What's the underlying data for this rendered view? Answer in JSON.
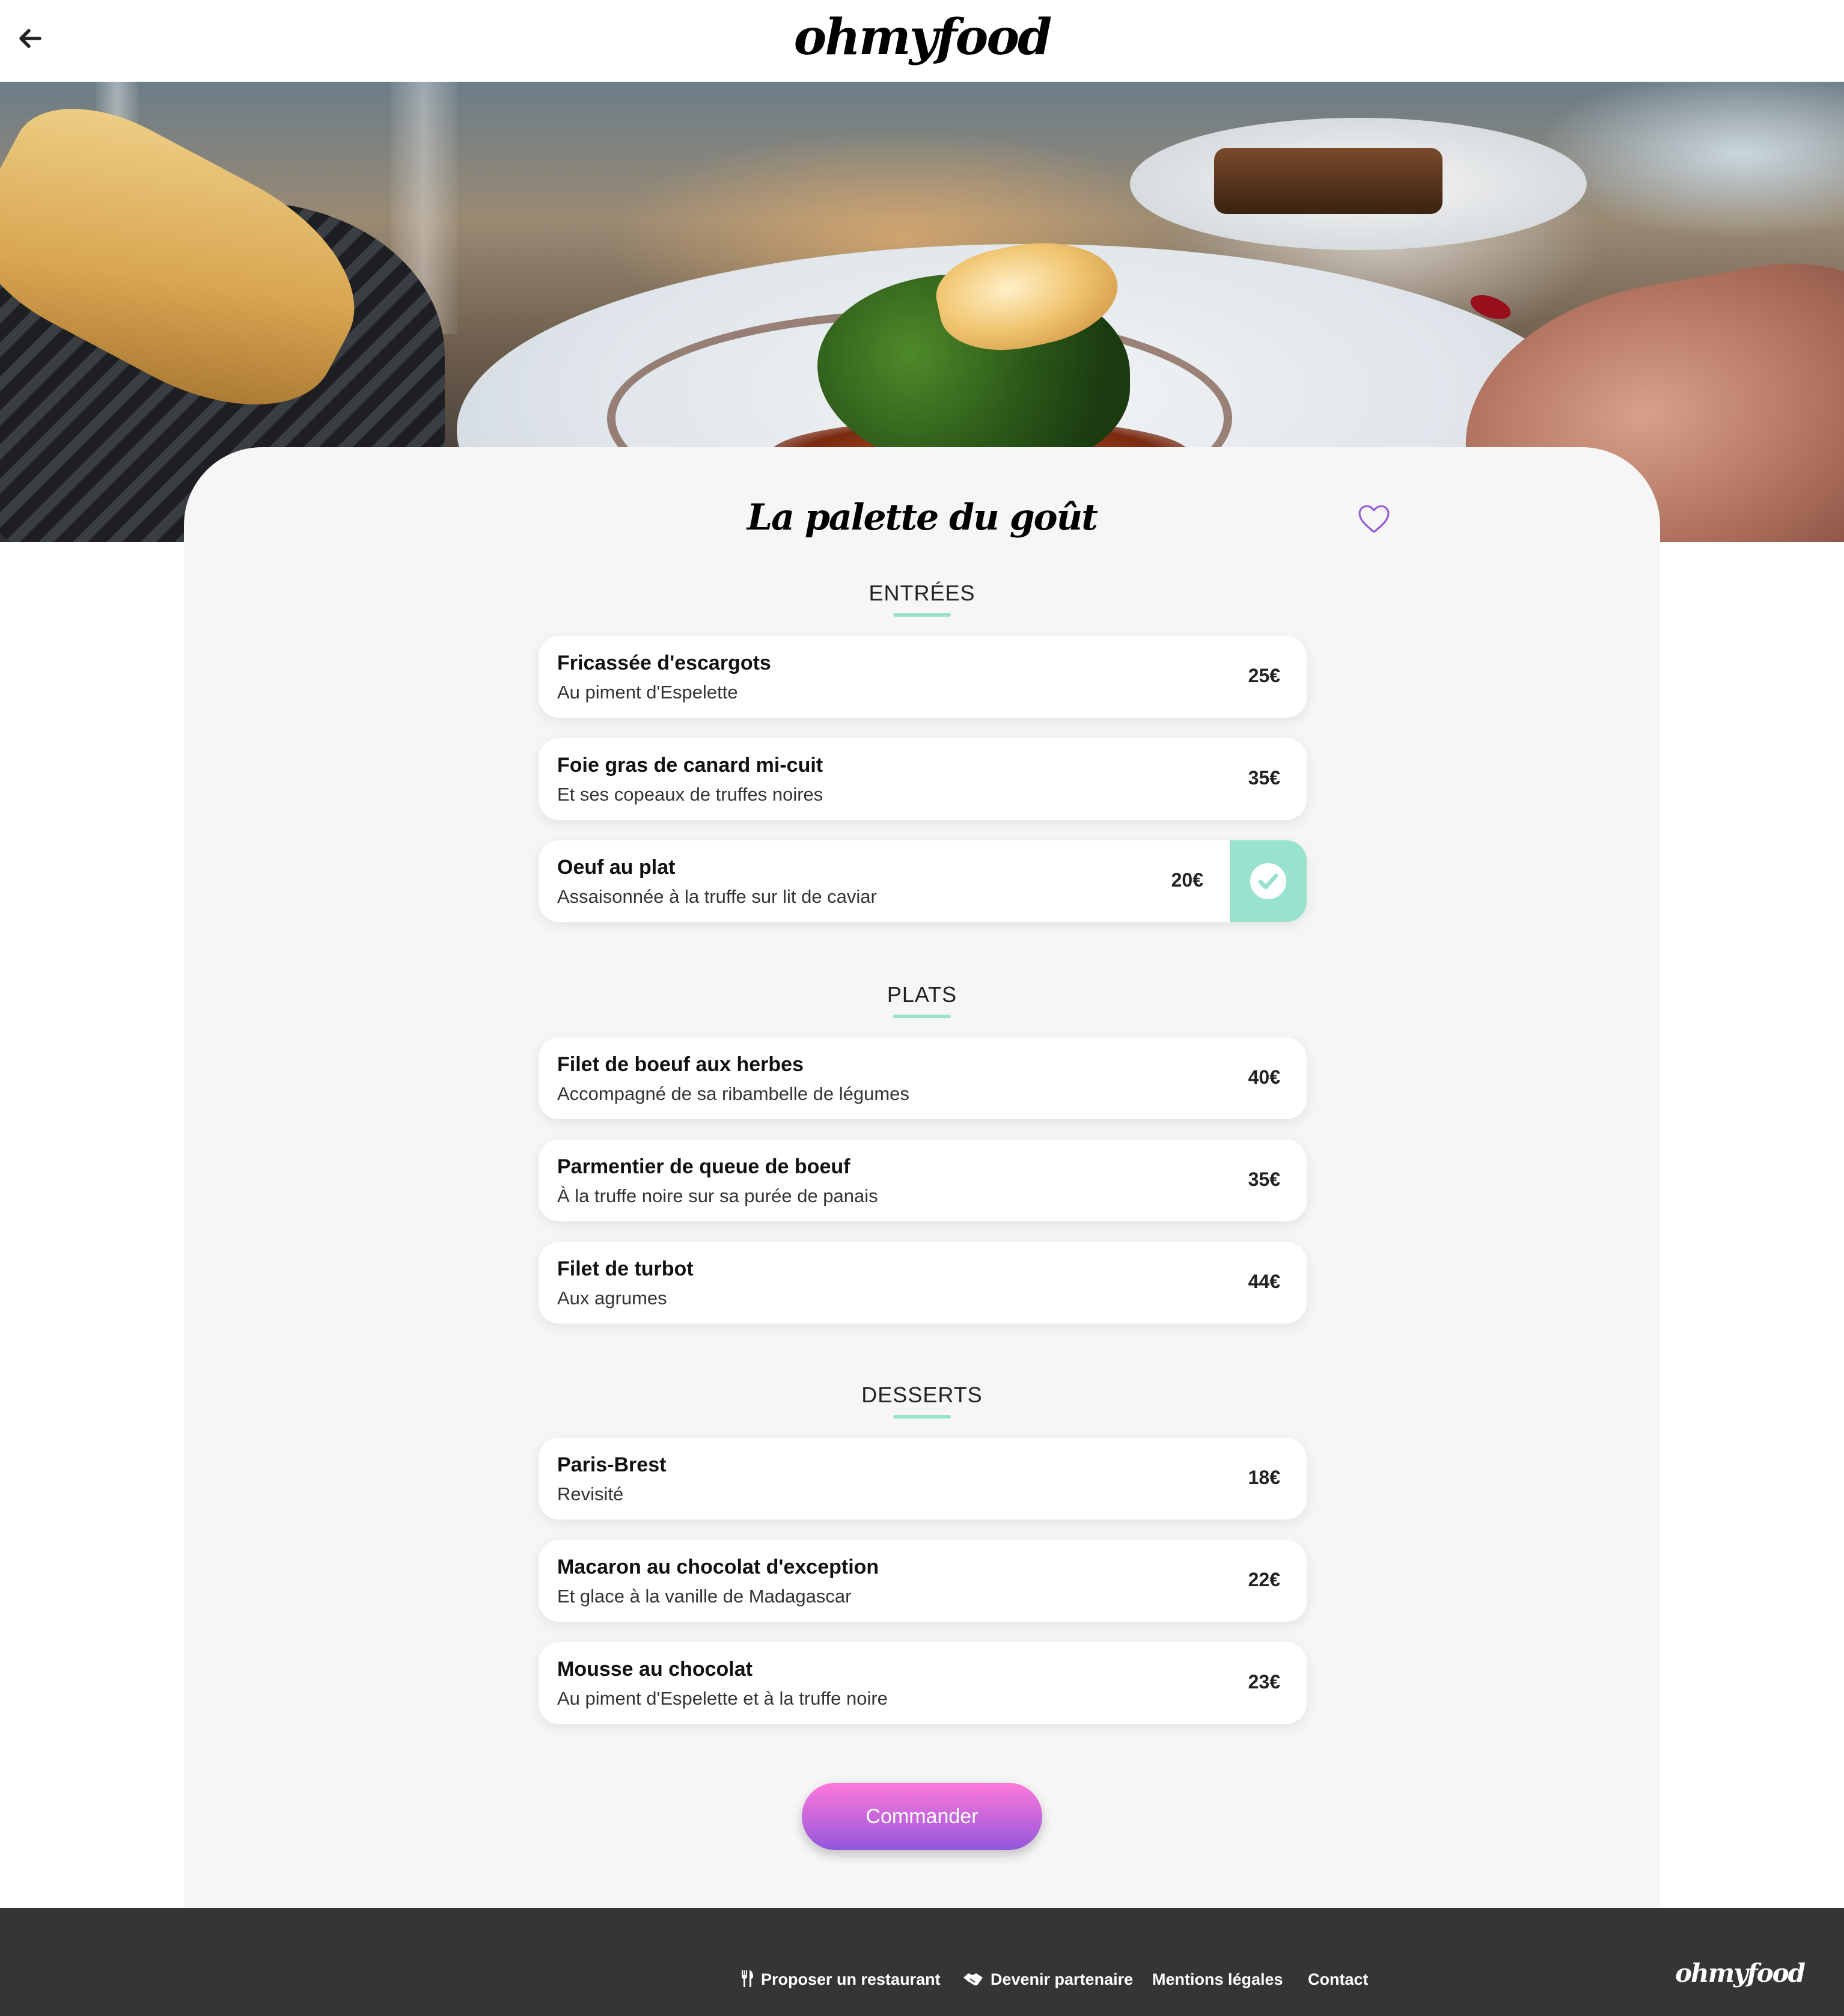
{
  "header": {
    "logo": "ohmyfood",
    "back_icon": "arrow-left-icon"
  },
  "hero": {
    "image": "restaurant-dish-photo"
  },
  "restaurant": {
    "title": "La palette du goût",
    "favorite_icon": "heart-outline-icon"
  },
  "menu": {
    "sections": [
      {
        "title": "ENTRÉES",
        "dishes": [
          {
            "name": "Fricassée d'escargots",
            "description": "Au piment d'Espelette",
            "price": "25€",
            "selected": false
          },
          {
            "name": "Foie gras de canard mi-cuit",
            "description": "Et ses copeaux de truffes noires",
            "price": "35€",
            "selected": false
          },
          {
            "name": "Oeuf au plat",
            "description": "Assaisonnée à la truffe sur lit de caviar",
            "price": "20€",
            "selected": true
          }
        ]
      },
      {
        "title": "PLATS",
        "dishes": [
          {
            "name": "Filet de boeuf aux herbes",
            "description": "Accompagné de sa ribambelle de légumes",
            "price": "40€",
            "selected": false
          },
          {
            "name": "Parmentier de queue de boeuf",
            "description": "À la truffe noire sur sa purée de panais",
            "price": "35€",
            "selected": false
          },
          {
            "name": "Filet de turbot",
            "description": "Aux agrumes",
            "price": "44€",
            "selected": false
          }
        ]
      },
      {
        "title": "DESSERTS",
        "dishes": [
          {
            "name": "Paris-Brest",
            "description": "Revisité",
            "price": "18€",
            "selected": false
          },
          {
            "name": "Macaron au chocolat d'exception",
            "description": "Et glace à la vanille de Madagascar",
            "price": "22€",
            "selected": false
          },
          {
            "name": "Mousse au chocolat",
            "description": "Au piment d'Espelette et à la truffe noire",
            "price": "23€",
            "selected": false
          }
        ]
      }
    ]
  },
  "order_button": {
    "label": "Commander"
  },
  "footer": {
    "links": [
      {
        "label": "Proposer un restaurant",
        "icon": "utensils-icon"
      },
      {
        "label": "Devenir partenaire",
        "icon": "handshake-icon"
      },
      {
        "label": "Mentions légales"
      },
      {
        "label": "Contact"
      }
    ],
    "logo": "ohmyfood"
  },
  "colors": {
    "accent": "#99e2d0",
    "button_top": "#ff79da",
    "button_bottom": "#9356dc",
    "favorite": "#9356dc",
    "footer_bg": "#353535",
    "card_bg": "#f6f6f6"
  }
}
